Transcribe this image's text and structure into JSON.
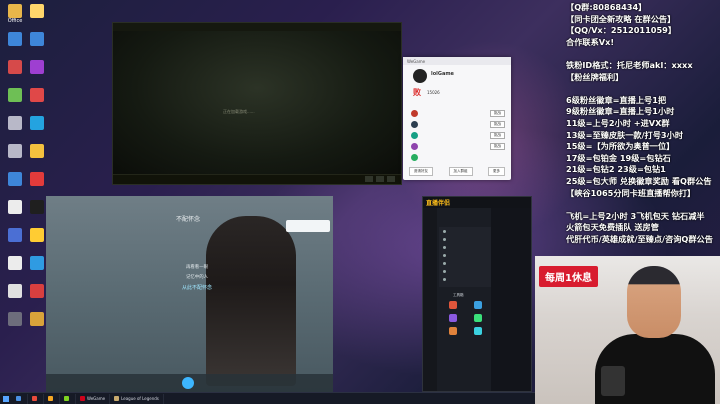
{
  "desktop": {
    "icons_left": [
      {
        "label": "Office",
        "color": "#e8b64a"
      },
      {
        "label": "",
        "color": "#3e86d9"
      },
      {
        "label": "",
        "color": "#d64a4a"
      },
      {
        "label": "",
        "color": "#6ebf55"
      },
      {
        "label": "",
        "color": "#b8b8c8"
      },
      {
        "label": "",
        "color": "#b8b8c8"
      },
      {
        "label": "",
        "color": "#3e86d9"
      },
      {
        "label": "",
        "color": "#ececec"
      },
      {
        "label": "",
        "color": "#4b6fd4"
      },
      {
        "label": "",
        "color": "#ececec"
      },
      {
        "label": "",
        "color": "#e0e0e0"
      },
      {
        "label": "",
        "color": "#6d6d7c"
      },
      {
        "label": "",
        "color": "#ffd66b"
      },
      {
        "label": "",
        "color": "#3e86d9"
      },
      {
        "label": "",
        "color": "#9e3fd1"
      },
      {
        "label": "",
        "color": "#e04848"
      },
      {
        "label": "",
        "color": "#24a3e0"
      },
      {
        "label": "",
        "color": "#f4c13e"
      },
      {
        "label": "",
        "color": "#e23b3b"
      },
      {
        "label": "",
        "color": "#1f1f1f"
      },
      {
        "label": "",
        "color": "#ffcc33"
      },
      {
        "label": "",
        "color": "#2f9be2"
      },
      {
        "label": "",
        "color": "#d83f3f"
      },
      {
        "label": "",
        "color": "#d9a33a"
      }
    ]
  },
  "game_window": {
    "loading_text": "正在加载游戏......"
  },
  "profile_card": {
    "app_name": "WeGame",
    "player_name": "lolGame",
    "rank_char": "败",
    "score": "15026",
    "friends": [
      {
        "name": "",
        "level": "",
        "action": "挑战",
        "color": "#c0392b"
      },
      {
        "name": "",
        "level": "",
        "action": "挑战",
        "color": "#2c3e50"
      },
      {
        "name": "",
        "level": "",
        "action": "挑战",
        "color": "#16a085"
      },
      {
        "name": "",
        "level": "",
        "action": "挑战",
        "color": "#8e44ad"
      },
      {
        "name": "",
        "level": "",
        "action": "",
        "color": "#27ae60"
      }
    ],
    "footer": [
      "邀请好友",
      "加入群组",
      "更多"
    ]
  },
  "music": {
    "song_title": "不配怀念",
    "artist": "",
    "lyrics": [
      {
        "text": "",
        "active": false
      },
      {
        "text": "再看看一眼",
        "active": false
      },
      {
        "text": "记忆中的人",
        "active": false
      },
      {
        "text": "从此不配怀念",
        "active": true
      },
      {
        "text": "",
        "active": false
      },
      {
        "text": "",
        "active": false
      },
      {
        "text": "",
        "active": false
      },
      {
        "text": "",
        "active": false
      }
    ],
    "now_playing": "",
    "comment_label": ""
  },
  "live_tool": {
    "logo": "直播伴侣",
    "section_label": "工具箱",
    "panel_items": [
      "",
      "",
      "",
      "",
      "",
      "",
      ""
    ],
    "tools": [
      {
        "label": "",
        "color": "#e0563b"
      },
      {
        "label": "",
        "color": "#3ba0e0"
      },
      {
        "label": "",
        "color": "#e0b93b"
      },
      {
        "label": "",
        "color": "#8a5ae0"
      },
      {
        "label": "",
        "color": "#3be07a"
      },
      {
        "label": "",
        "color": "#e03b8a"
      },
      {
        "label": "",
        "color": "#e0823b"
      },
      {
        "label": "",
        "color": "#3bd1e0"
      },
      {
        "label": "",
        "color": "#c2c2c2"
      }
    ]
  },
  "notice": {
    "lines": [
      "【Q群:80868434】",
      "【同卡团全新攻略 在群公告】",
      "【QQ/Vx：2512011059】",
      "合作联系Vx!",
      "",
      "铁粉ID格式：托尼老师akl：xxxx",
      "【粉丝牌福利】",
      "",
      "6级粉丝徽章=直播上号1把",
      "9级粉丝徽章=直播上号1小时",
      "11级=上号2小时  +进VX群",
      "13级=至臻皮肤一款/打号3小时",
      "15级=【为所欲为奥普一位】",
      "17级=包铂金    19级=包钻石",
      "21级=包钻2     23级=包钻1",
      "25级=包大师  兑换徽章奖励 看Q群公告",
      "【峡谷1065分同卡班直播帮你打】",
      "",
      "飞机=上号2小时  3飞机包天 钻石减半",
      "火箭包天免费插队 送房管",
      "代肝代币/英雄成就/至臻点/咨询Q群公告"
    ]
  },
  "cam": {
    "badge": "每周1休息"
  },
  "taskbar": {
    "tasks": [
      {
        "label": "",
        "color": "#4a90e2"
      },
      {
        "label": "",
        "color": "#e94b3c"
      },
      {
        "label": "",
        "color": "#f5a623"
      },
      {
        "label": "",
        "color": "#7ed321"
      },
      {
        "label": "WeGame",
        "color": "#d0021b"
      },
      {
        "label": "League of Legends",
        "color": "#c8aa6e"
      }
    ]
  }
}
